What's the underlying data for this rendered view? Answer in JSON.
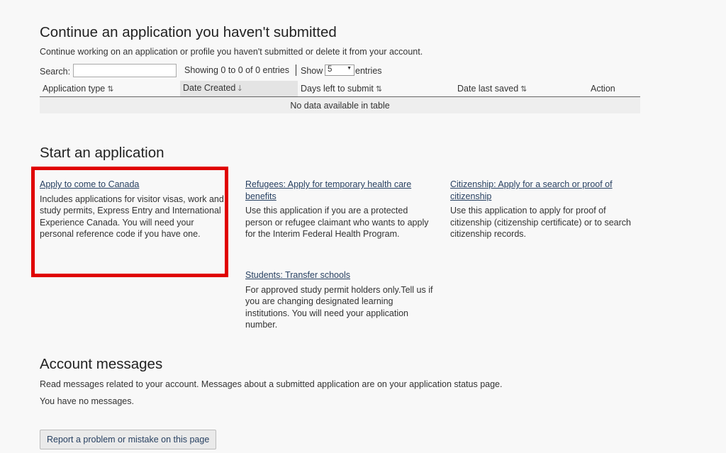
{
  "continue_section": {
    "title": "Continue an application you haven't submitted",
    "description": "Continue working on an application or profile you haven't submitted or delete it from your account.",
    "search_label": "Search:",
    "search_value": "",
    "showing_text": "Showing 0 to 0 of 0 entries",
    "show_label": "Show",
    "page_size": "5",
    "entries_label": "entries",
    "columns": [
      "Application type",
      "Date Created",
      "Days left to submit",
      "Date last saved",
      "Action"
    ],
    "sort_icons": {
      "unsorted": "⇅",
      "descending": "🡓"
    },
    "empty_message": "No data available in table"
  },
  "start_section": {
    "title": "Start an application",
    "cards": [
      {
        "link": "Apply to come to Canada",
        "text": "Includes applications for visitor visas, work and study permits, Express Entry and International Experience Canada. You will need your personal reference code if you have one."
      },
      {
        "link": "Refugees: Apply for temporary health care benefits",
        "text": "Use this application if you are a protected person or refugee claimant who wants to apply for the Interim Federal Health Program."
      },
      {
        "link": "Citizenship: Apply for a search or proof of citizenship",
        "text": "Use this application to apply for proof of citizenship (citizenship certificate) or to search citizenship records."
      },
      {
        "link": "Students: Transfer schools",
        "text": "For approved study permit holders only.Tell us if you are changing designated learning institutions. You will need your application number."
      }
    ]
  },
  "messages_section": {
    "title": "Account messages",
    "description": "Read messages related to your account. Messages about a submitted application are on your application status page.",
    "empty": "You have no messages."
  },
  "report_button": "Report a problem or mistake on this page",
  "colors": {
    "link": "#284162",
    "highlight_box": "#e00000",
    "background": "#f8f8f8"
  }
}
